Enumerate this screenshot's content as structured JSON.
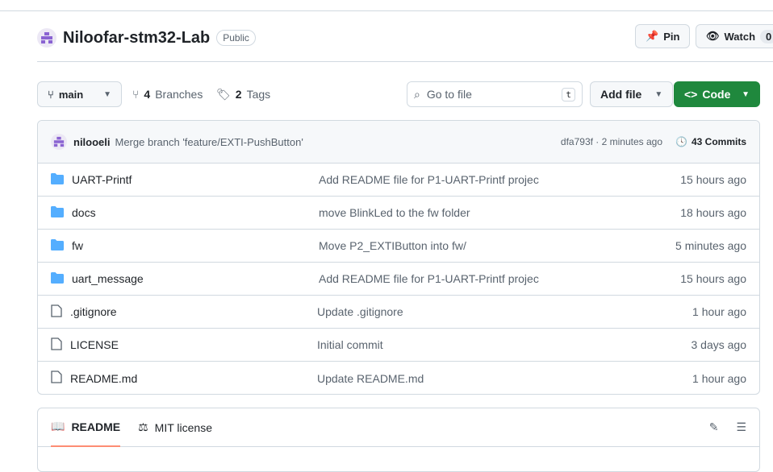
{
  "repo": {
    "name": "Niloofar-stm32-Lab",
    "visibility": "Public",
    "pin": "Pin",
    "watch": "Watch",
    "watch_count": "0"
  },
  "toolbar": {
    "branch": "main",
    "branches_count": "4",
    "branches_label": "Branches",
    "tags_count": "2",
    "tags_label": "Tags",
    "search_placeholder": "Go to file",
    "search_key": "t",
    "add_file": "Add file",
    "code": "Code",
    "code_color": "#1f883d"
  },
  "commit": {
    "author": "nilooeli",
    "message": "Merge branch 'feature/EXTI-PushButton'",
    "meta": "dfa793f · 2 minutes ago",
    "commits": "43 Commits"
  },
  "files": [
    {
      "name": "UART-Printf",
      "type": "folder",
      "message": "Add README file for P1-UART-Printf projec",
      "time": "15 hours ago"
    },
    {
      "name": "docs",
      "type": "folder",
      "message": "move BlinkLed to the fw folder",
      "time": "18 hours ago"
    },
    {
      "name": "fw",
      "type": "folder",
      "message": "Move P2_EXTIButton into fw/",
      "time": "5 minutes ago"
    },
    {
      "name": "uart_message",
      "type": "folder",
      "message": "Add README file for P1-UART-Printf projec",
      "time": "15 hours ago"
    },
    {
      "name": ".gitignore",
      "type": "file",
      "message": "Update .gitignore",
      "time": "1 hour ago"
    },
    {
      "name": "LICENSE",
      "type": "file",
      "message": "Initial commit",
      "time": "3 days ago"
    },
    {
      "name": "README.md",
      "type": "file",
      "message": "Update README.md",
      "time": "1 hour ago"
    }
  ],
  "readme": {
    "tab1": "README",
    "tab2": "MIT license"
  }
}
